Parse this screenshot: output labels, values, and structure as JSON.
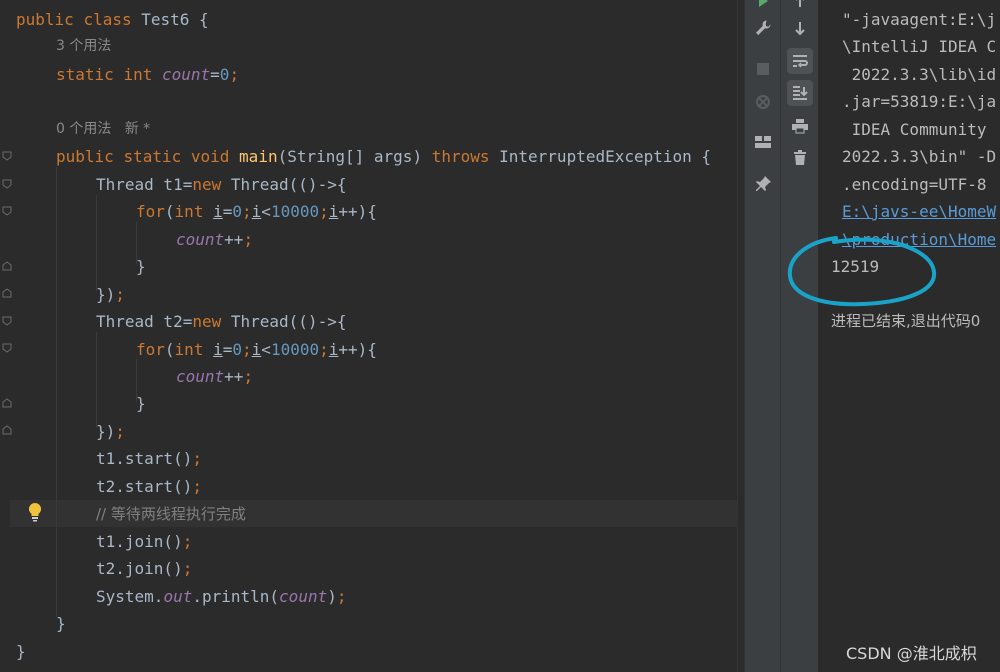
{
  "editor": {
    "class_decl": {
      "kw1": "public",
      "kw2": "class",
      "name": "Test6",
      "brace": " {"
    },
    "usage_hint_1": "3 个用法",
    "field_decl": {
      "kw1": "static",
      "kw2": "int",
      "name": "count",
      "eq": "=",
      "value": "0",
      "semi": ";"
    },
    "usage_hint_2": "0 个用法   新 *",
    "main_decl": {
      "kw1": "public",
      "kw2": "static",
      "kw3": "void",
      "name": "main",
      "params": "(String[] args) ",
      "throws": "throws",
      "exc": " InterruptedException {"
    },
    "t1_decl": {
      "type": "Thread t1=",
      "new": "new",
      "rest": " Thread(()->{"
    },
    "for1": {
      "kw": "for",
      "p1": "(",
      "int": "int",
      "sp": " ",
      "i1": "i",
      "eq": "=",
      "zero": "0",
      "semi1": ";",
      "i2": "i",
      "lt": "<",
      "limit": "10000",
      "semi2": ";",
      "i3": "i",
      "inc": "++){"
    },
    "body1": {
      "var": "count",
      "op": "++",
      "semi": ";"
    },
    "close_brace_1": "}",
    "close_lambda_1": {
      "text": "})",
      "semi": ";"
    },
    "t2_decl": {
      "type": "Thread t2=",
      "new": "new",
      "rest": " Thread(()->{"
    },
    "for2": {
      "kw": "for",
      "p1": "(",
      "int": "int",
      "sp": " ",
      "i1": "i",
      "eq": "=",
      "zero": "0",
      "semi1": ";",
      "i2": "i",
      "lt": "<",
      "limit": "10000",
      "semi2": ";",
      "i3": "i",
      "inc": "++){"
    },
    "body2": {
      "var": "count",
      "op": "++",
      "semi": ";"
    },
    "close_brace_2": "}",
    "close_lambda_2": {
      "text": "})",
      "semi": ";"
    },
    "start1": {
      "text": "t1.start()",
      "semi": ";"
    },
    "start2": {
      "text": "t2.start()",
      "semi": ";"
    },
    "comment": "// 等待两线程执行完成",
    "join1": {
      "text": "t1.join()",
      "semi": ";"
    },
    "join2": {
      "text": "t2.join()",
      "semi": ";"
    },
    "println": {
      "pre": "System.",
      "out": "out",
      "mid": ".println(",
      "arg": "count",
      "post": ")",
      "semi": ";"
    },
    "close_main": "}",
    "close_class": "}"
  },
  "console": {
    "lines": [
      "\"-javaagent:E:\\j",
      "\\IntelliJ IDEA C",
      " 2022.3.3\\lib\\id",
      ".jar=53819:E:\\ja",
      " IDEA Community",
      "2022.3.3\\bin\" -D",
      ".encoding=UTF-8"
    ],
    "link_lines": [
      "E:\\javs-ee\\HomeW",
      "\\production\\Home"
    ],
    "output": "12519",
    "exit_msg": "进程已结束,退出代码0"
  },
  "watermark": "CSDN @淮北成枳",
  "colors": {
    "editor_bg": "#2b2b2b",
    "keyword": "#cc7832",
    "field": "#9876aa",
    "number": "#6897bb",
    "method": "#ffc66d",
    "annotation_circle": "#1aa3c9"
  },
  "icons": [
    "run-icon",
    "wrench-icon",
    "stop-icon",
    "rerun-failed-icon",
    "layout-icon",
    "pin-icon",
    "up-arrow-icon",
    "down-arrow-icon",
    "soft-wrap-icon",
    "scroll-to-end-icon",
    "print-icon",
    "trash-icon",
    "lightbulb-icon"
  ]
}
